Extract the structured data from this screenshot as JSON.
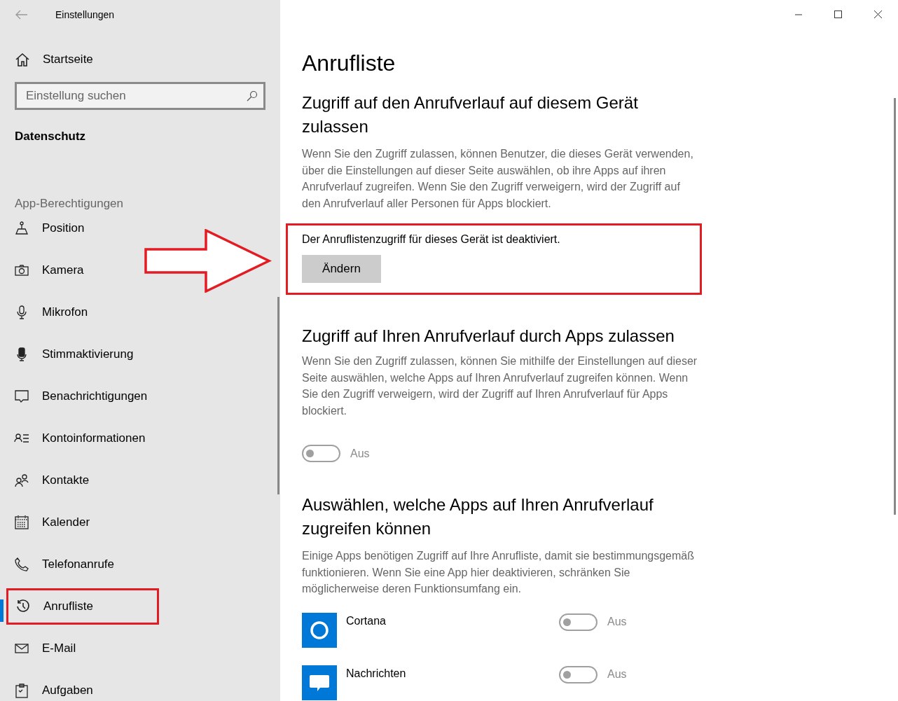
{
  "window": {
    "title": "Einstellungen"
  },
  "sidebar": {
    "home": "Startseite",
    "search": {
      "placeholder": "Einstellung suchen"
    },
    "section": "Datenschutz",
    "group": "App-Berechtigungen",
    "items": [
      {
        "label": "Position",
        "selected": false
      },
      {
        "label": "Kamera",
        "selected": false
      },
      {
        "label": "Mikrofon",
        "selected": false
      },
      {
        "label": "Stimmaktivierung",
        "selected": false
      },
      {
        "label": "Benachrichtigungen",
        "selected": false
      },
      {
        "label": "Kontoinformationen",
        "selected": false
      },
      {
        "label": "Kontakte",
        "selected": false
      },
      {
        "label": "Kalender",
        "selected": false
      },
      {
        "label": "Telefonanrufe",
        "selected": false
      },
      {
        "label": "Anrufliste",
        "selected": true
      },
      {
        "label": "E-Mail",
        "selected": false
      },
      {
        "label": "Aufgaben",
        "selected": false
      }
    ]
  },
  "page": {
    "title": "Anrufliste",
    "device_section": {
      "heading": "Zugriff auf den Anrufverlauf auf diesem Gerät zulassen",
      "description": "Wenn Sie den Zugriff zulassen, können Benutzer, die dieses Gerät verwenden, über die Einstellungen auf dieser Seite auswählen, ob ihre Apps auf ihren Anrufverlauf zugreifen. Wenn Sie den Zugriff verweigern, wird der Zugriff auf den Anrufverlauf aller Personen für Apps blockiert.",
      "status": "Der Anruflistenzugriff für dieses Gerät ist deaktiviert.",
      "button": "Ändern"
    },
    "apps_section": {
      "heading": "Zugriff auf Ihren Anrufverlauf durch Apps zulassen",
      "description": "Wenn Sie den Zugriff zulassen, können Sie mithilfe der Einstellungen auf dieser Seite auswählen, welche Apps auf Ihren Anrufverlauf zugreifen können. Wenn Sie den Zugriff verweigern, wird der Zugriff auf Ihren Anrufverlauf für Apps blockiert.",
      "toggle": {
        "on": false,
        "disabled": true,
        "label": "Aus"
      }
    },
    "choose_section": {
      "heading": "Auswählen, welche Apps auf Ihren Anrufverlauf zugreifen können",
      "description": "Einige Apps benötigen Zugriff auf Ihre Anrufliste, damit sie bestimmungsgemäß funktionieren. Wenn Sie eine App hier deaktivieren, schränken Sie möglicherweise deren Funktionsumfang ein.",
      "apps": [
        {
          "name": "Cortana",
          "kind": "cortana",
          "toggle": {
            "on": false,
            "disabled": true,
            "label": "Aus"
          }
        },
        {
          "name": "Nachrichten",
          "kind": "messages",
          "toggle": {
            "on": false,
            "disabled": true,
            "label": "Aus"
          }
        }
      ]
    }
  }
}
